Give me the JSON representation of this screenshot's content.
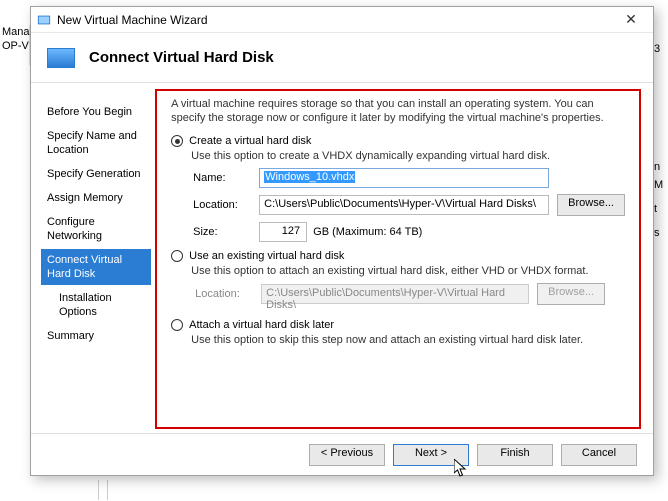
{
  "bg": {
    "left1": "Manag",
    "left2": "OP-V",
    "right1": "3",
    "right2": "n M",
    "right3": "t",
    "right4": "s"
  },
  "titlebar": {
    "title": "New Virtual Machine Wizard"
  },
  "header": {
    "title": "Connect Virtual Hard Disk"
  },
  "sidebar": {
    "steps": [
      {
        "label": "Before You Begin"
      },
      {
        "label": "Specify Name and Location"
      },
      {
        "label": "Specify Generation"
      },
      {
        "label": "Assign Memory"
      },
      {
        "label": "Configure Networking"
      },
      {
        "label": "Connect Virtual Hard Disk"
      },
      {
        "label": "Installation Options"
      },
      {
        "label": "Summary"
      }
    ]
  },
  "content": {
    "description": "A virtual machine requires storage so that you can install an operating system. You can specify the storage now or configure it later by modifying the virtual machine's properties.",
    "opt_create": {
      "label": "Create a virtual hard disk",
      "hint": "Use this option to create a VHDX dynamically expanding virtual hard disk.",
      "name_label": "Name:",
      "name_value": "Windows_10.vhdx",
      "loc_label": "Location:",
      "loc_value": "C:\\Users\\Public\\Documents\\Hyper-V\\Virtual Hard Disks\\",
      "browse_label": "Browse...",
      "size_label": "Size:",
      "size_value": "127",
      "size_unit": "GB (Maximum: 64 TB)"
    },
    "opt_existing": {
      "label": "Use an existing virtual hard disk",
      "hint": "Use this option to attach an existing virtual hard disk, either VHD or VHDX format.",
      "loc_label": "Location:",
      "loc_value": "C:\\Users\\Public\\Documents\\Hyper-V\\Virtual Hard Disks\\",
      "browse_label": "Browse..."
    },
    "opt_later": {
      "label": "Attach a virtual hard disk later",
      "hint": "Use this option to skip this step now and attach an existing virtual hard disk later."
    }
  },
  "footer": {
    "previous": "< Previous",
    "next": "Next >",
    "finish": "Finish",
    "cancel": "Cancel"
  }
}
